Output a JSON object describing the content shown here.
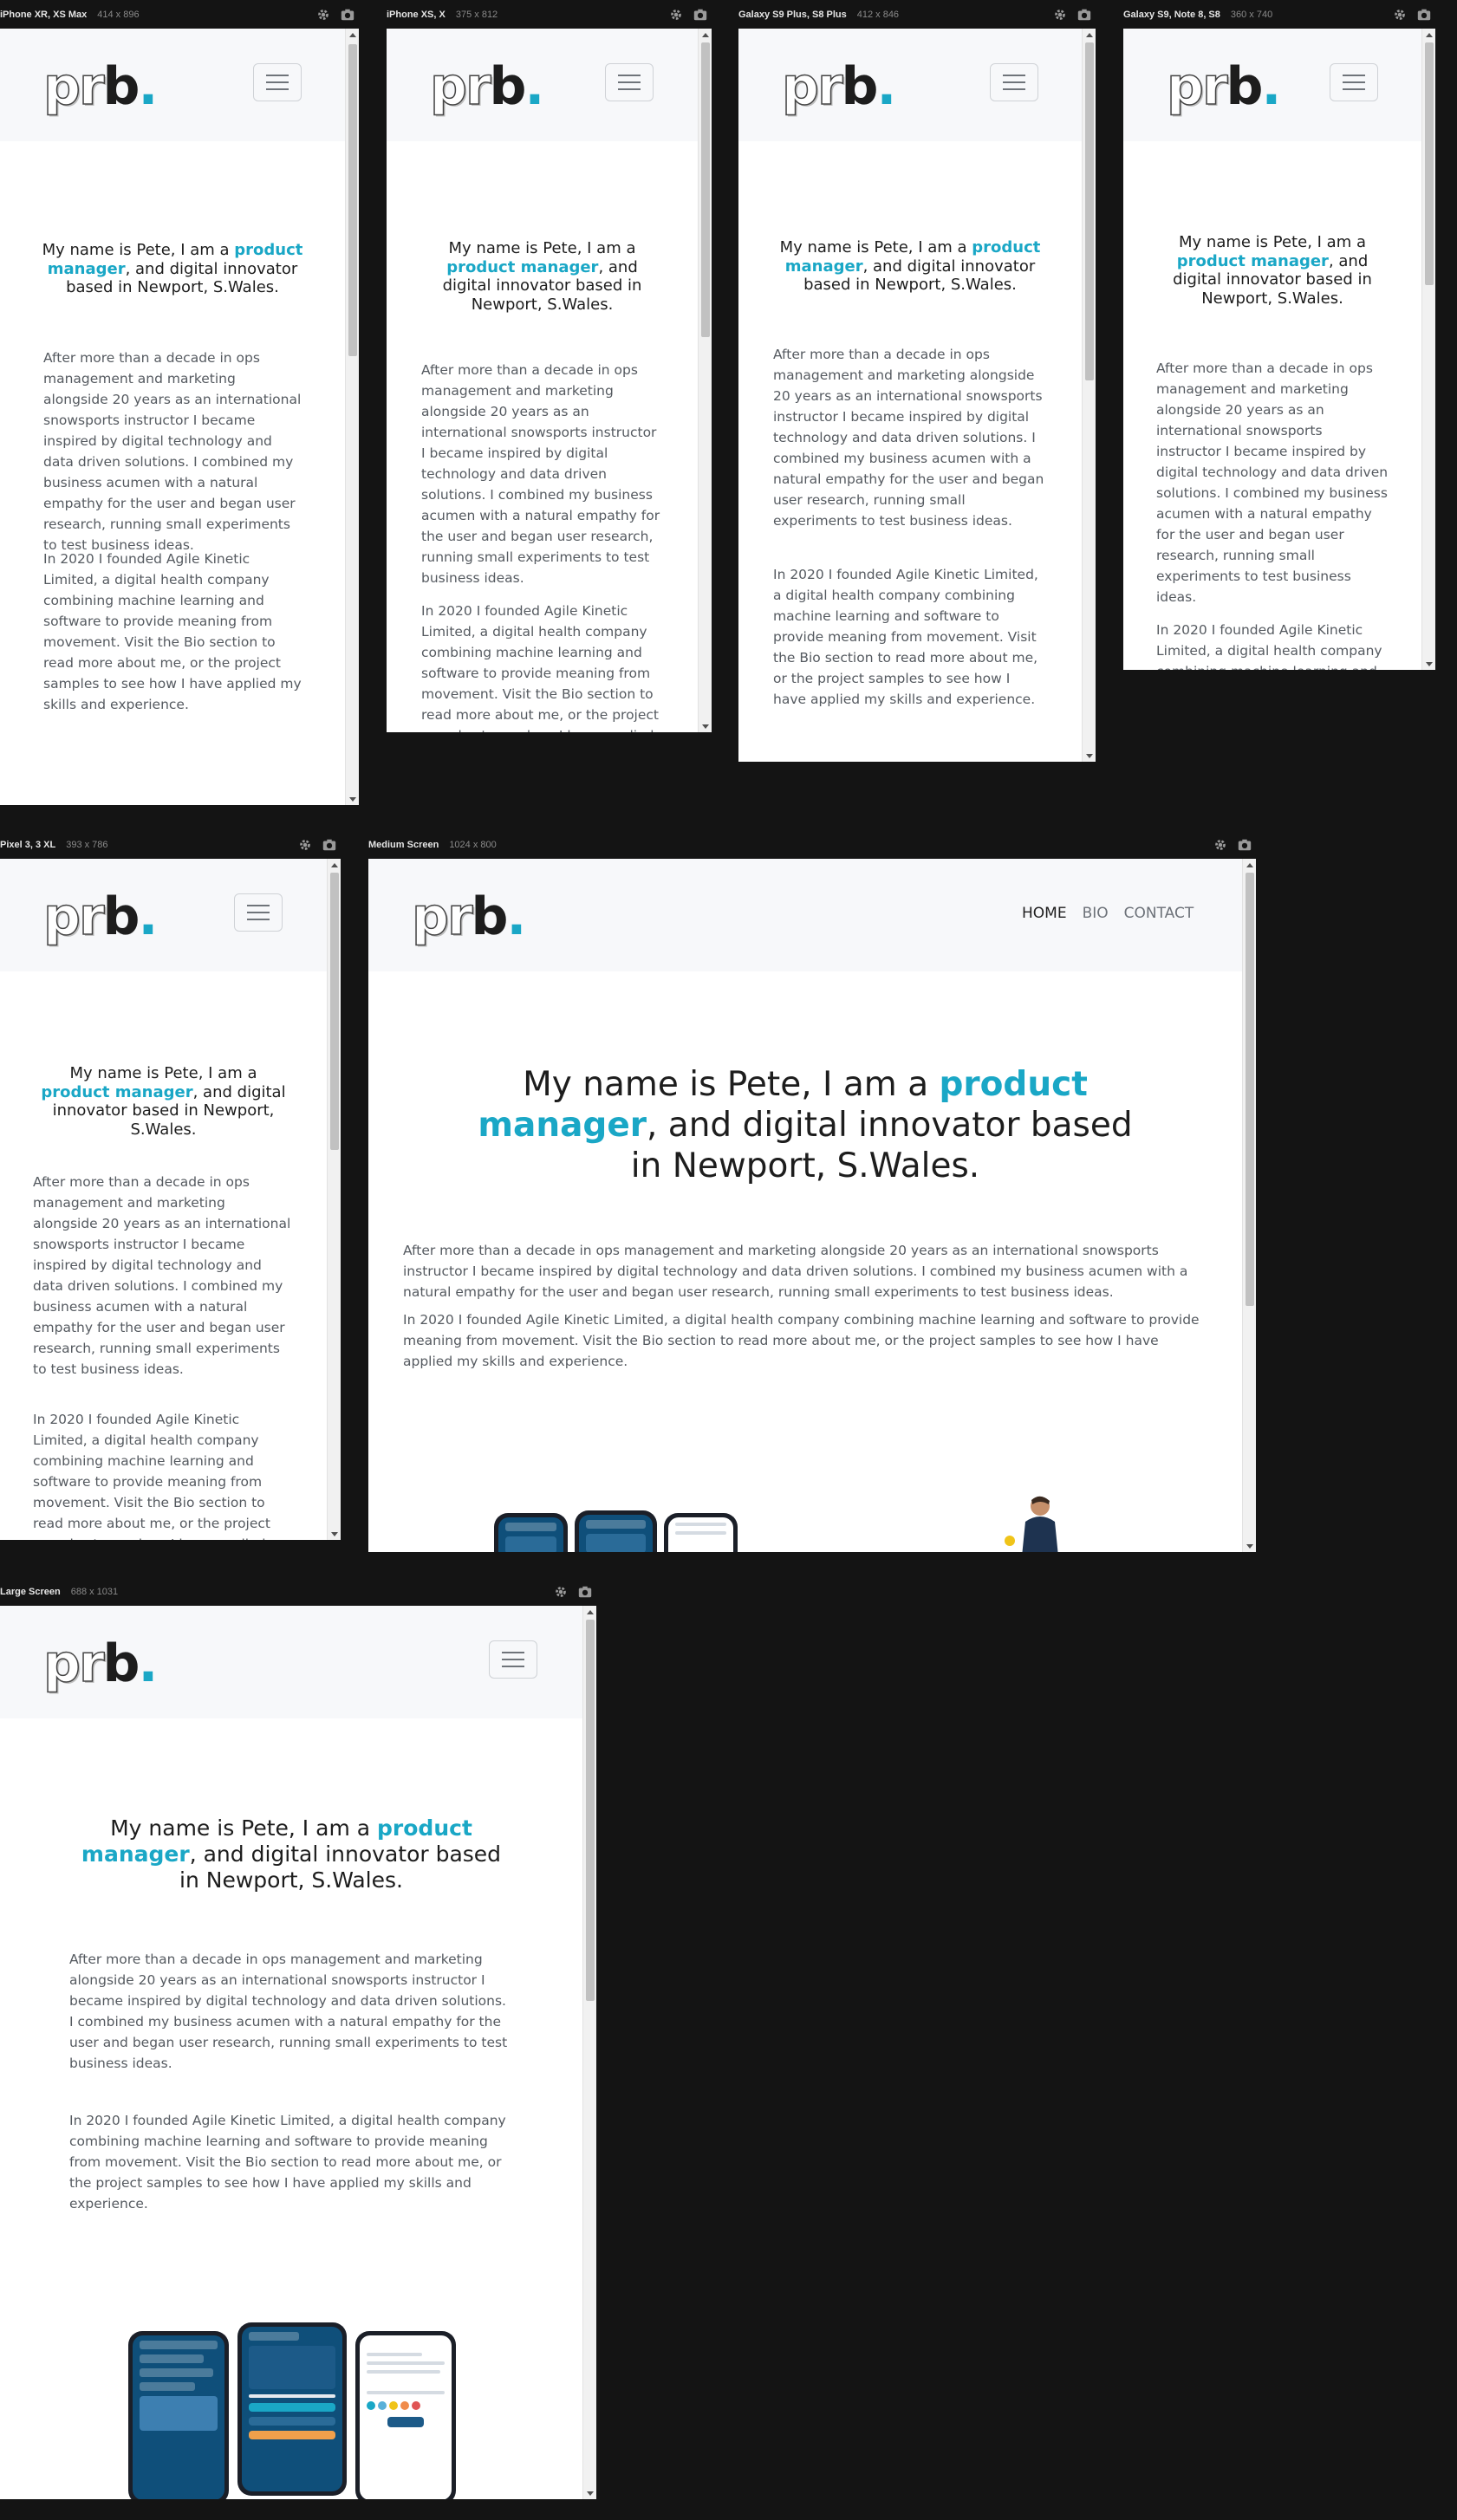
{
  "site": {
    "logo_letters": "prb",
    "logo_dot": ".",
    "headline_prefix": "My name is Pete, I am a ",
    "headline_accent": "product manager",
    "headline_suffix": ", and digital innovator based in Newport, S.Wales.",
    "para1": "After more than a decade in ops management and marketing alongside 20 years as an international snowsports instructor I became inspired by digital technology and data driven solutions. I combined my business acumen with a natural empathy for the user and began user research, running small experiments to test business ideas.",
    "para2": "In 2020 I founded Agile Kinetic Limited, a digital health company combining machine learning and software to provide meaning from movement. Visit the Bio section to read more about me, or the project samples to see how I have applied my skills and experience.",
    "nav": {
      "home": "HOME",
      "bio": "BIO",
      "contact": "CONTACT"
    },
    "accent_color": "#1aa7c6"
  },
  "devices": {
    "iphone_xr": {
      "name": "iPhone XR, XS Max",
      "size": "414 x 896"
    },
    "iphone_xs": {
      "name": "iPhone XS, X",
      "size": "375 x 812"
    },
    "galaxy_s9_plus": {
      "name": "Galaxy S9 Plus, S8 Plus",
      "size": "412 x 846"
    },
    "galaxy_s9": {
      "name": "Galaxy S9, Note 8, S8",
      "size": "360 x 740"
    },
    "pixel3": {
      "name": "Pixel 3, 3 XL",
      "size": "393 x 786"
    },
    "medium": {
      "name": "Medium Screen",
      "size": "1024 x 800"
    },
    "large": {
      "name": "Large Screen",
      "size": "688 x 1031"
    }
  },
  "icons": {
    "settings": "gear-icon",
    "screenshot": "camera-icon",
    "menu": "hamburger-icon"
  }
}
